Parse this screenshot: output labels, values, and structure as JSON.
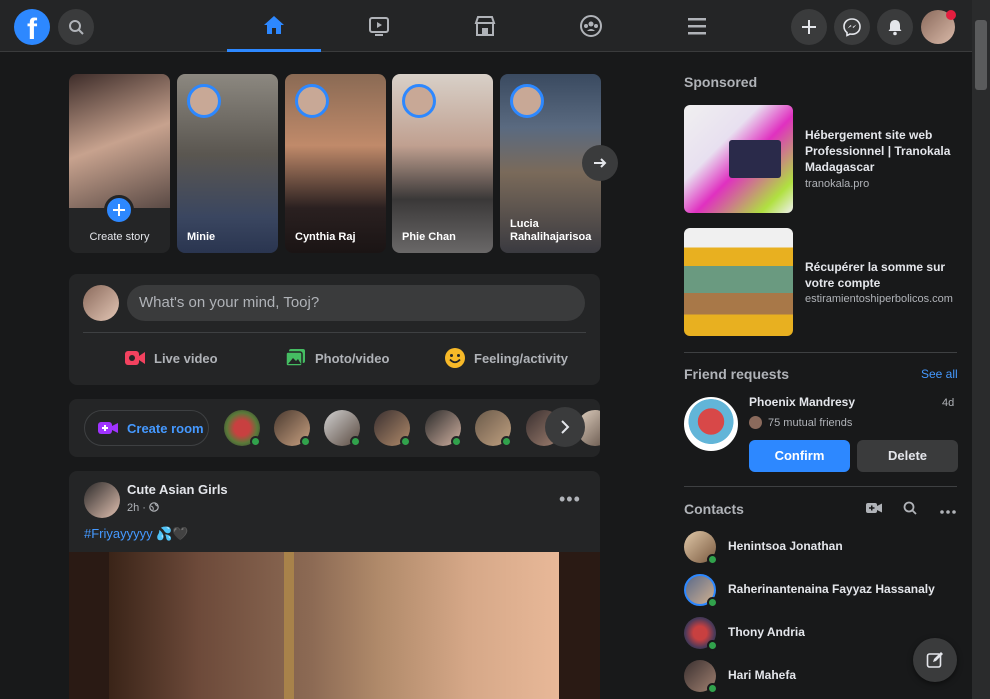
{
  "topbar": {
    "logo_letter": "f",
    "nav_tabs": [
      "home",
      "watch",
      "marketplace",
      "groups",
      "menu"
    ],
    "active_tab": "home"
  },
  "stories": {
    "create_label": "Create story",
    "items": [
      {
        "name": "Minie"
      },
      {
        "name": "Cynthia Raj"
      },
      {
        "name": "Phie Chan"
      },
      {
        "name": "Lucia Rahalihajarisoa"
      }
    ]
  },
  "composer": {
    "placeholder": "What's on your mind, Tooj?",
    "actions": {
      "live_video": "Live video",
      "photo_video": "Photo/video",
      "feeling": "Feeling/activity"
    }
  },
  "rooms": {
    "create_label": "Create room"
  },
  "post": {
    "author": "Cute Asian Girls",
    "time": "2h ·",
    "hashtag": "#Friyayyyyy",
    "emoji": " 💦🖤",
    "more": "•••"
  },
  "sidebar": {
    "sponsored_title": "Sponsored",
    "ads": [
      {
        "title": "Hébergement site web Professionnel | Tranokala Madagascar",
        "domain": "tranokala.pro"
      },
      {
        "title": "Récupérer la somme sur votre compte",
        "domain": "estiramientoshiperbolicos.com"
      }
    ],
    "friend_requests": {
      "title": "Friend requests",
      "see_all": "See all",
      "name": "Phoenix Mandresy",
      "date": "4d",
      "mutual": "75 mutual friends",
      "confirm": "Confirm",
      "delete": "Delete"
    },
    "contacts": {
      "title": "Contacts",
      "items": [
        {
          "name": "Henintsoa Jonathan"
        },
        {
          "name": "Raherinantenaina Fayyaz Hassanaly"
        },
        {
          "name": "Thony Andria"
        },
        {
          "name": "Hari Mahefa"
        }
      ]
    }
  },
  "colors": {
    "accent": "#2d88ff",
    "background": "#18191a",
    "surface": "#242526",
    "online": "#31a24c"
  }
}
